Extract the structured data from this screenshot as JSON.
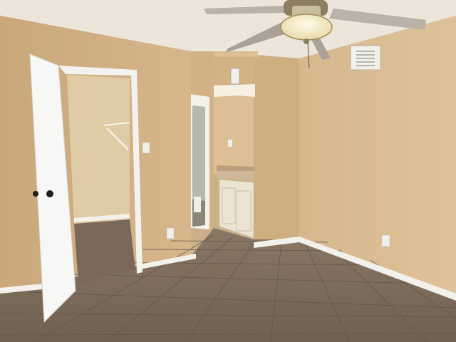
{
  "photo": {
    "subject": "",
    "colors": {
      "wall": "#d9b98f",
      "wall_shadow": "#c9a97f",
      "ceiling": "#ece6dc",
      "floor": "#7d6c5c",
      "floor_grout": "#6a5b4d",
      "trim": "#f3f1ec",
      "door": "#f7f7f5",
      "cabinet": "#ece4d2",
      "fan_blade": "#b9b2a6",
      "fan_light": "#f4ecd2"
    }
  }
}
